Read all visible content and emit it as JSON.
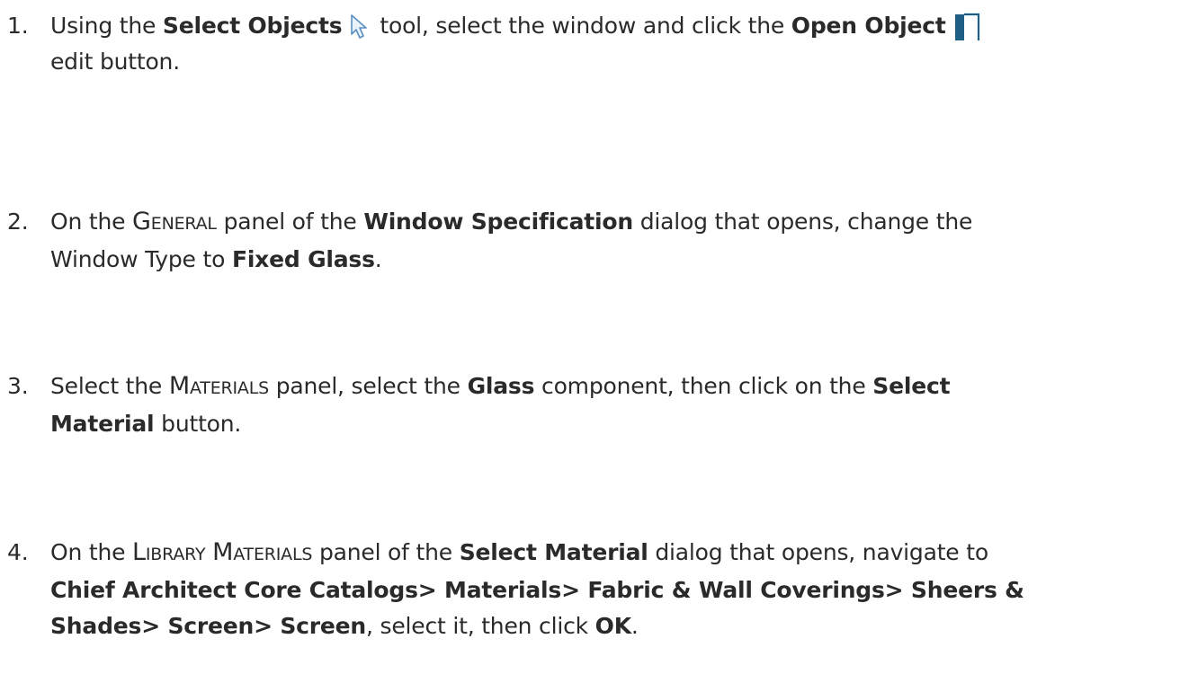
{
  "steps": [
    {
      "number": "1.",
      "t1": "Using the ",
      "b1": "Select Objects",
      "t2": "tool, select the window and click the",
      "b2": "Open Object",
      "icon1": "select-objects-arrow-icon",
      "icon2": "open-object-door-icon",
      "line2": "edit button."
    },
    {
      "number": "2.",
      "t1": "On the ",
      "sc_g": "G",
      "sc_eneral": "ENERAL",
      "t2": " panel of the ",
      "b1": "Window Specification",
      "t3": " dialog that opens, change the",
      "t4": "Window Type to ",
      "b2": "Fixed Glass",
      "t5": "."
    },
    {
      "number": "3.",
      "t1": "Select the ",
      "sc_m": "M",
      "sc_aterials": "ATERIALS",
      "t2": " panel, select the ",
      "b1": "Glass",
      "t3": " component, then click on the ",
      "b2": "Select",
      "b3": "Material",
      "t4": " button."
    },
    {
      "number": "4.",
      "t1": "On the ",
      "sc_l": "L",
      "sc_ibrary": "IBRARY",
      "sc_m": "M",
      "sc_aterials": "ATERIALS",
      "t2": " panel of the ",
      "b1": "Select Material",
      "t3": " dialog that opens, navigate to",
      "b2": "Chief Architect Core Catalogs> Materials> Fabric & Wall Coverings> Sheers &",
      "b3": "Shades> Screen> Screen",
      "t4": ", select it, then click ",
      "b4": "OK",
      "t5": "."
    }
  ],
  "colors": {
    "text": "#2a2a2a",
    "icon_door": "#1f5f85",
    "icon_arrow_stroke": "#5a8fc2"
  }
}
